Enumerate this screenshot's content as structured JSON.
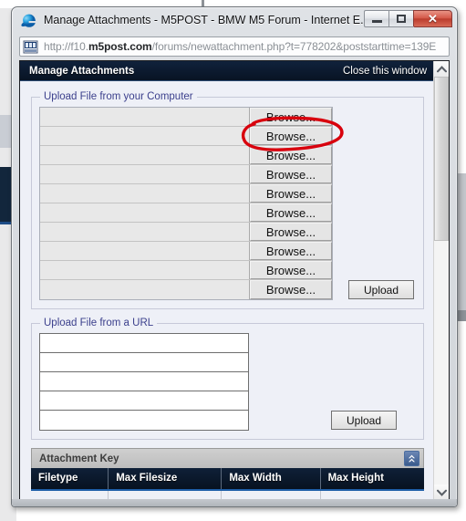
{
  "browser": {
    "window_title": "Manage Attachments - M5POST - BMW M5 Forum - Internet E...",
    "app_icon": "internet-explorer-icon",
    "address_icon": "page-icon",
    "url_full": "http://f10.m5post.com/forums/newattachment.php?t=778202&poststarttime=139E",
    "url_parts": {
      "pre": "http://f10.",
      "host_bold": "m5post.com",
      "post": "/forums/newattachment.php?t=778202&poststarttime=139E"
    },
    "window_controls": {
      "minimize": "minimize-button",
      "maximize": "maximize-button",
      "close": "close-button",
      "close_glyph": "✕"
    }
  },
  "page": {
    "header": {
      "title": "Manage Attachments",
      "close_link": "Close this window"
    },
    "upload_computer": {
      "legend": "Upload File from your Computer",
      "rows": [
        {
          "value": "",
          "button": "Browse...",
          "annotated": true
        },
        {
          "value": "",
          "button": "Browse...",
          "annotated": false
        },
        {
          "value": "",
          "button": "Browse...",
          "annotated": false
        },
        {
          "value": "",
          "button": "Browse...",
          "annotated": false
        },
        {
          "value": "",
          "button": "Browse...",
          "annotated": false
        },
        {
          "value": "",
          "button": "Browse...",
          "annotated": false
        },
        {
          "value": "",
          "button": "Browse...",
          "annotated": false
        },
        {
          "value": "",
          "button": "Browse...",
          "annotated": false
        },
        {
          "value": "",
          "button": "Browse...",
          "annotated": false
        },
        {
          "value": "",
          "button": "Browse...",
          "annotated": false
        }
      ],
      "upload_button": "Upload"
    },
    "upload_url": {
      "legend": "Upload File from a URL",
      "inputs": [
        "",
        "",
        "",
        "",
        ""
      ],
      "upload_button": "Upload"
    },
    "attachment_key": {
      "title": "Attachment Key",
      "collapse_icon": "collapse-arrows-icon",
      "columns": [
        "Filetype",
        "Max Filesize",
        "Max Width",
        "Max Height"
      ]
    },
    "scrollbar": {
      "up_arrow": "scroll-up-arrow-icon",
      "down_arrow": "scroll-down-arrow-icon"
    }
  },
  "annotation": {
    "shape": "hand-drawn-ellipse",
    "color": "#d8000d",
    "targets": "first-browse-button"
  }
}
